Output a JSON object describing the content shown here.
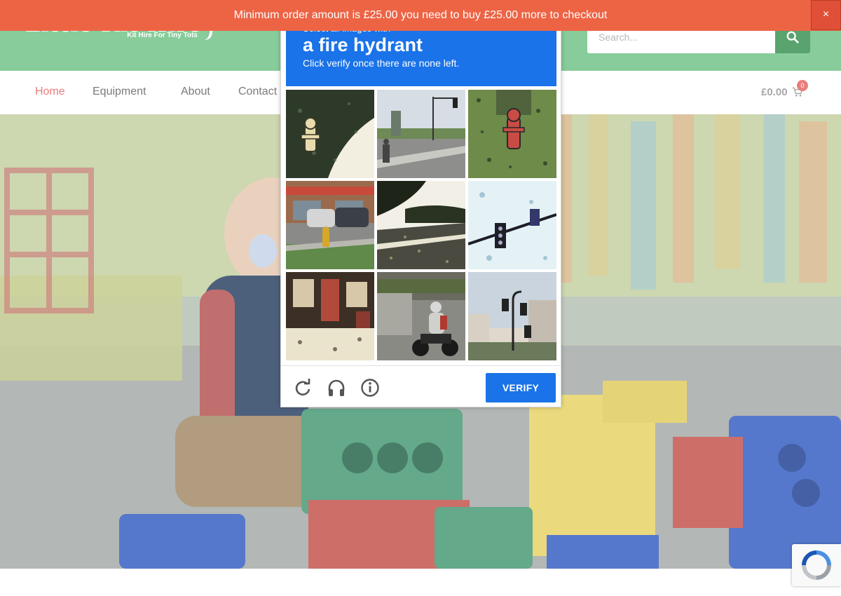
{
  "notice": {
    "text": "Minimum order amount is £25.00 you need to buy £25.00 more to checkout",
    "close_label": "×"
  },
  "header": {
    "logo_text": "Little Kit Hire",
    "logo_tagline": "Kit Hire For Tiny Tots",
    "partial_nav_text": "t",
    "search_placeholder": "Search...",
    "search_icon": "search-icon"
  },
  "nav": {
    "items": [
      {
        "label": "Home",
        "active": true
      },
      {
        "label": "Equipment",
        "active": false
      },
      {
        "label": "About",
        "active": false
      },
      {
        "label": "Contact",
        "active": false
      }
    ],
    "cart_total": "£0.00",
    "cart_count": "0",
    "cart_icon": "cart-icon"
  },
  "captcha": {
    "prompt": "Select all images with",
    "object": "a fire hydrant",
    "instruction": "Click verify once there are none left.",
    "tiles": [
      {
        "content": "fire hydrant on grass"
      },
      {
        "content": "street crossing with traffic lights"
      },
      {
        "content": "red fire hydrant on grass"
      },
      {
        "content": "storefront with parked cars and fire hydrant"
      },
      {
        "content": "road and trees"
      },
      {
        "content": "traffic light against sky"
      },
      {
        "content": "building storefront"
      },
      {
        "content": "motorcyclist on road"
      },
      {
        "content": "traffic lights near buildings"
      }
    ],
    "verify_label": "VERIFY",
    "icons": [
      "reload-icon",
      "audio-icon",
      "info-icon"
    ],
    "accent_color": "#1a73e8"
  },
  "colors": {
    "header_green": "#87cc9a",
    "notice_orange": "#ed6445",
    "nav_active": "#e97d7d"
  }
}
